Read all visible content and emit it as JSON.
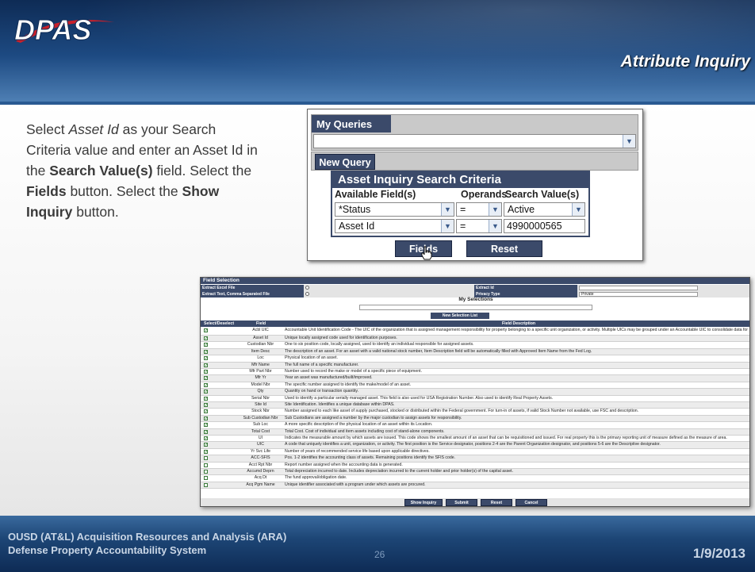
{
  "header": {
    "logo_text": "DPAS",
    "page_title": "Attribute Inquiry"
  },
  "instructions": {
    "p1": "Select ",
    "asset_id": "Asset Id",
    "p2": " as your Search Criteria value and enter an Asset Id in the ",
    "search_value": "Search Value(s)",
    "p3": " field. Select the ",
    "fields": "Fields",
    "p4": " button. Select the ",
    "show_inquiry": "Show Inquiry",
    "p5": " button."
  },
  "dialog": {
    "my_queries": "My Queries",
    "new_query": "New Query",
    "criteria_title": "Asset Inquiry Search Criteria",
    "col_available": "Available Field(s)",
    "col_operands": "Operands",
    "col_search": "Search Value(s)",
    "rows": [
      {
        "field": "*Status",
        "operand": "=",
        "value": "Active"
      },
      {
        "field": "Asset Id",
        "operand": "=",
        "value": "4990000565"
      }
    ],
    "fields_button": "Fields",
    "reset_button": "Reset"
  },
  "field_selection": {
    "title": "Field Selection",
    "extract_excel": "Extract Excel File",
    "extract_text": "Extract Text, Comma Separated File",
    "extract_id": "Extract Id",
    "privacy_type": "Privacy Type",
    "privacy_value": "Private",
    "my_selections": "My Selections",
    "new_selection_list": "New Selection List",
    "col_select": "Select/Deselect",
    "col_field": "Field",
    "col_desc": "Field Description",
    "rows": [
      {
        "checked": true,
        "field": "Acbl UIC",
        "desc": "Accountable Unit Identification Code - The UIC of the organization that is assigned management responsibility for property belonging to a specific unit organization, or activity. Multiple UICs may be grouped under an Accountable UIC to consolidate data for accountability and accounting system reporting purposes."
      },
      {
        "checked": true,
        "field": "Asset Id",
        "desc": "Unique locally assigned code used for identification purposes."
      },
      {
        "checked": true,
        "field": "Custodian Nbr",
        "desc": "One to six position code, locally assigned, used to identify an individual responsible for assigned assets."
      },
      {
        "checked": true,
        "field": "Item Desc",
        "desc": "The description of an asset. For an asset with a valid national stock number, Item Description field will be automatically filled with Approved Item Name from the Fed Log."
      },
      {
        "checked": true,
        "field": "Loc",
        "desc": "Physical location of an asset."
      },
      {
        "checked": true,
        "field": "Mfr Name",
        "desc": "The full name of a specific manufacturer."
      },
      {
        "checked": true,
        "field": "Mfr Part Nbr",
        "desc": "Number used to record the make or model of a specific piece of equipment."
      },
      {
        "checked": true,
        "field": "Mfr Yr",
        "desc": "Year an asset was manufactured/built/improved."
      },
      {
        "checked": true,
        "field": "Model Nbr",
        "desc": "The specific number assigned to identify the make/model of an asset."
      },
      {
        "checked": true,
        "field": "Qty",
        "desc": "Quantity on hand or transaction quantity."
      },
      {
        "checked": true,
        "field": "Serial Nbr",
        "desc": "Used to identify a particular serially managed asset. This field is also used for USA Registration Number. Also used to identify Real Property Assets."
      },
      {
        "checked": true,
        "field": "Site Id",
        "desc": "Site Identification. Identifies a unique database within DPAS."
      },
      {
        "checked": true,
        "field": "Stock Nbr",
        "desc": "Number assigned to each like asset of supply purchased, stocked or distributed within the Federal government. For turn-in of assets, if valid Stock Number not available, use FSC and description."
      },
      {
        "checked": true,
        "field": "Sub Custodian Nbr",
        "desc": "Sub Custodians are assigned a number by the major custodian to assign assets for responsibility."
      },
      {
        "checked": true,
        "field": "Sub Loc",
        "desc": "A more specific description of the physical location of an asset within its Location."
      },
      {
        "checked": true,
        "field": "Total Cost",
        "desc": "Total Cost. Cost of individual and item assets including cost of stand-alone components."
      },
      {
        "checked": true,
        "field": "UI",
        "desc": "Indicates the measurable amount by which assets are issued. This code shows the smallest amount of an asset that can be requisitioned and issued. For real property this is the primary reporting unit of measure defined as the measure of area."
      },
      {
        "checked": true,
        "field": "UIC",
        "desc": "A code that uniquely identifies a unit, organization, or activity. The first position is the Service designator, positions 2-4 are the Parent Organization designator, and positions 5-6 are the Descriptive designator."
      },
      {
        "checked": true,
        "field": "Yr Svc Life",
        "desc": "Number of years of recommended service life based upon applicable directives."
      },
      {
        "checked": false,
        "field": "ACC-SFIS",
        "desc": "Pos. 1-2 identifies the accounting class of assets. Remaining positions identify the SFIS code."
      },
      {
        "checked": false,
        "field": "Acct Rpt Nbr",
        "desc": "Report number assigned when the accounting data is generated."
      },
      {
        "checked": false,
        "field": "Accumd Deprn",
        "desc": "Total depreciation incurred to date. Includes depreciation incurred to the current holder and prior holder(s) of the capital asset."
      },
      {
        "checked": false,
        "field": "Acq Dt",
        "desc": "The fund approval/obligation date."
      },
      {
        "checked": false,
        "field": "Acq Pgm Name",
        "desc": "Unique identifier associated with a program under which assets are procured."
      }
    ],
    "buttons": {
      "show_inquiry": "Show Inquiry",
      "submit": "Submit",
      "reset": "Reset",
      "cancel": "Cancel"
    }
  },
  "footer": {
    "org_line1": "OUSD (AT&L) Acquisition Resources and Analysis (ARA)",
    "org_line2": "Defense Property Accountability System",
    "page_number": "26",
    "date": "1/9/2013"
  }
}
